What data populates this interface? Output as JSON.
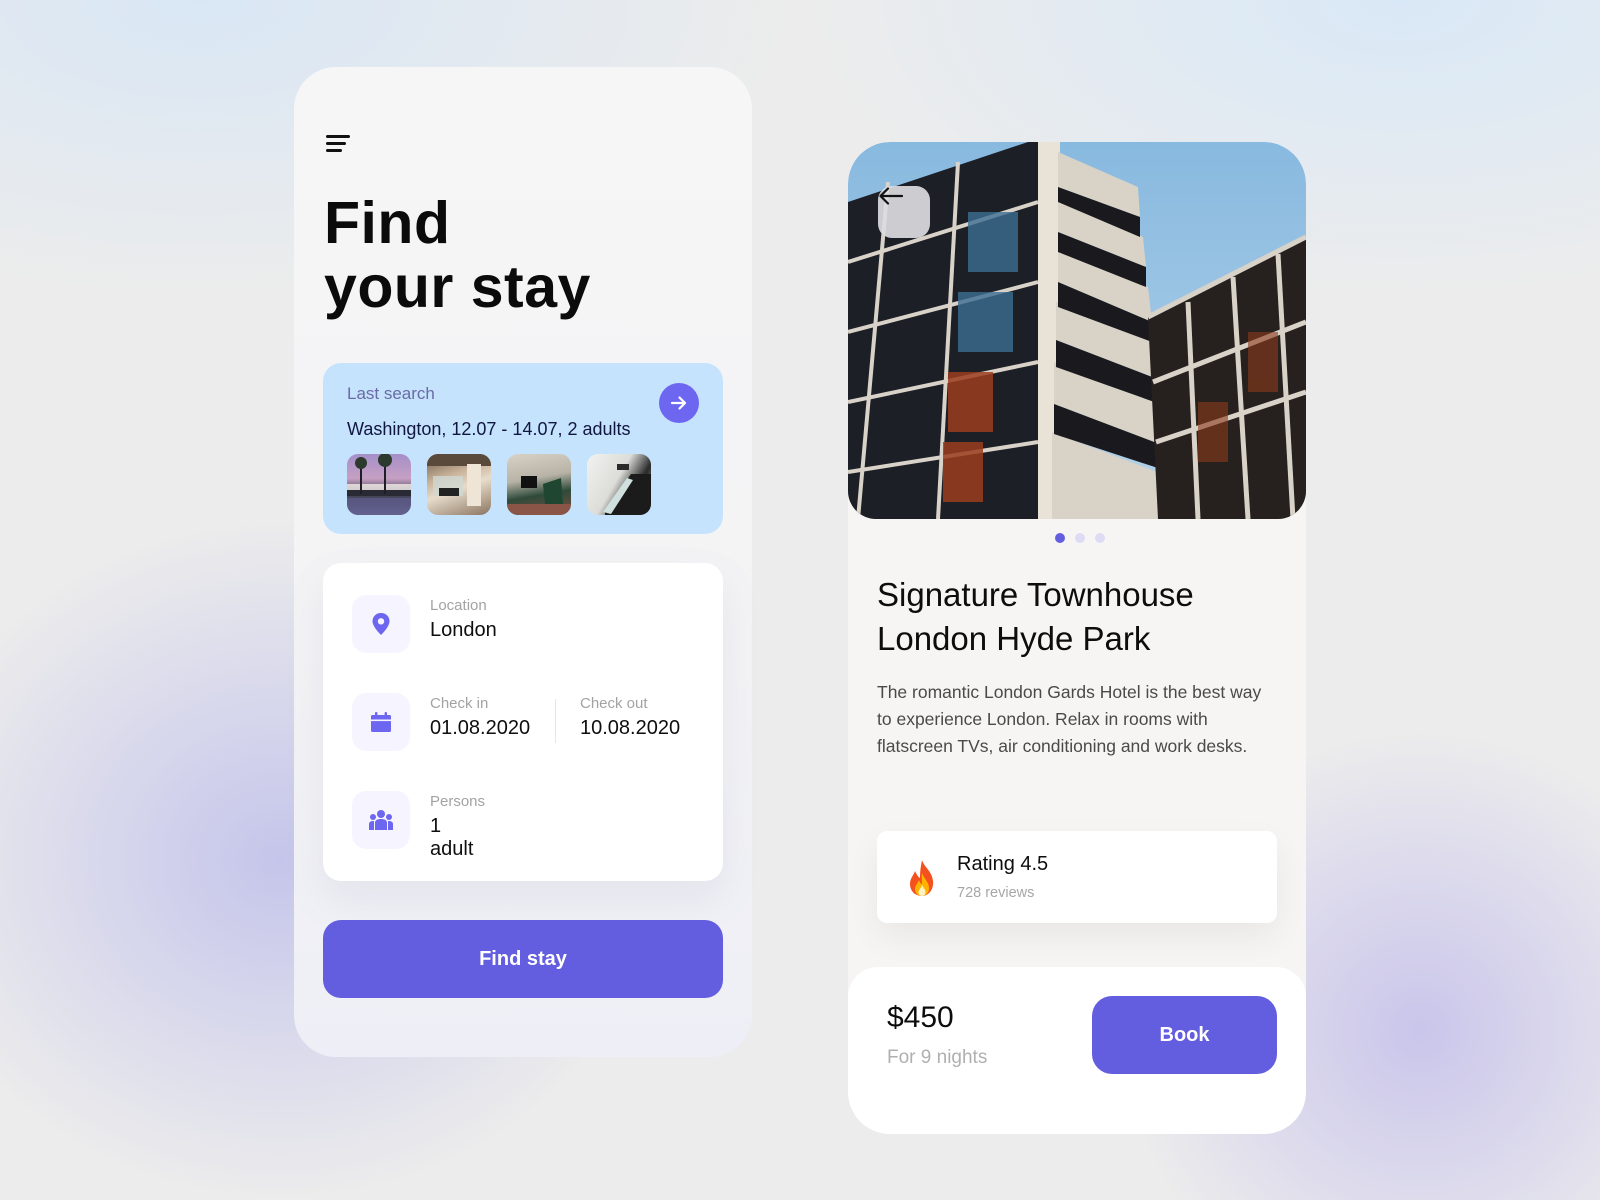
{
  "colors": {
    "accent": "#635de0",
    "accent_light": "#6d66f0",
    "last_search_bg": "#c5e3fd",
    "icon_tile_bg": "#f6f5ff"
  },
  "search_screen": {
    "menu_icon": "menu-icon",
    "title_line1": "Find",
    "title_line2": "your stay",
    "last_search": {
      "label": "Last search",
      "value": "Washington, 12.07 - 14.07, 2 adults",
      "go_icon": "arrow-right-icon",
      "thumbnails": [
        {
          "name": "thumbnail-resort-pool"
        },
        {
          "name": "thumbnail-lobby"
        },
        {
          "name": "thumbnail-lounge"
        },
        {
          "name": "thumbnail-staircase"
        }
      ]
    },
    "form": {
      "location": {
        "icon": "location-pin-icon",
        "label": "Location",
        "value": "London"
      },
      "check_in": {
        "icon": "calendar-icon",
        "label": "Check in",
        "value": "01.08.2020"
      },
      "check_out": {
        "label": "Check out",
        "value": "10.08.2020"
      },
      "persons": {
        "icon": "people-icon",
        "label": "Persons",
        "value": "1 adult"
      }
    },
    "find_button": "Find stay"
  },
  "detail_screen": {
    "back_icon": "arrow-left-icon",
    "carousel": {
      "total": 3,
      "active": 1
    },
    "hotel_name_line1": "Signature Townhouse",
    "hotel_name_line2": "London Hyde Park",
    "description": "The romantic London Gards Hotel is the best way to experience London. Relax in rooms with flatscreen TVs, air conditioning and work desks.",
    "rating": {
      "icon": "fire-icon",
      "title": "Rating 4.5",
      "reviews": "728 reviews"
    },
    "price": "$450",
    "price_note": "For 9 nights",
    "book_button": "Book"
  }
}
